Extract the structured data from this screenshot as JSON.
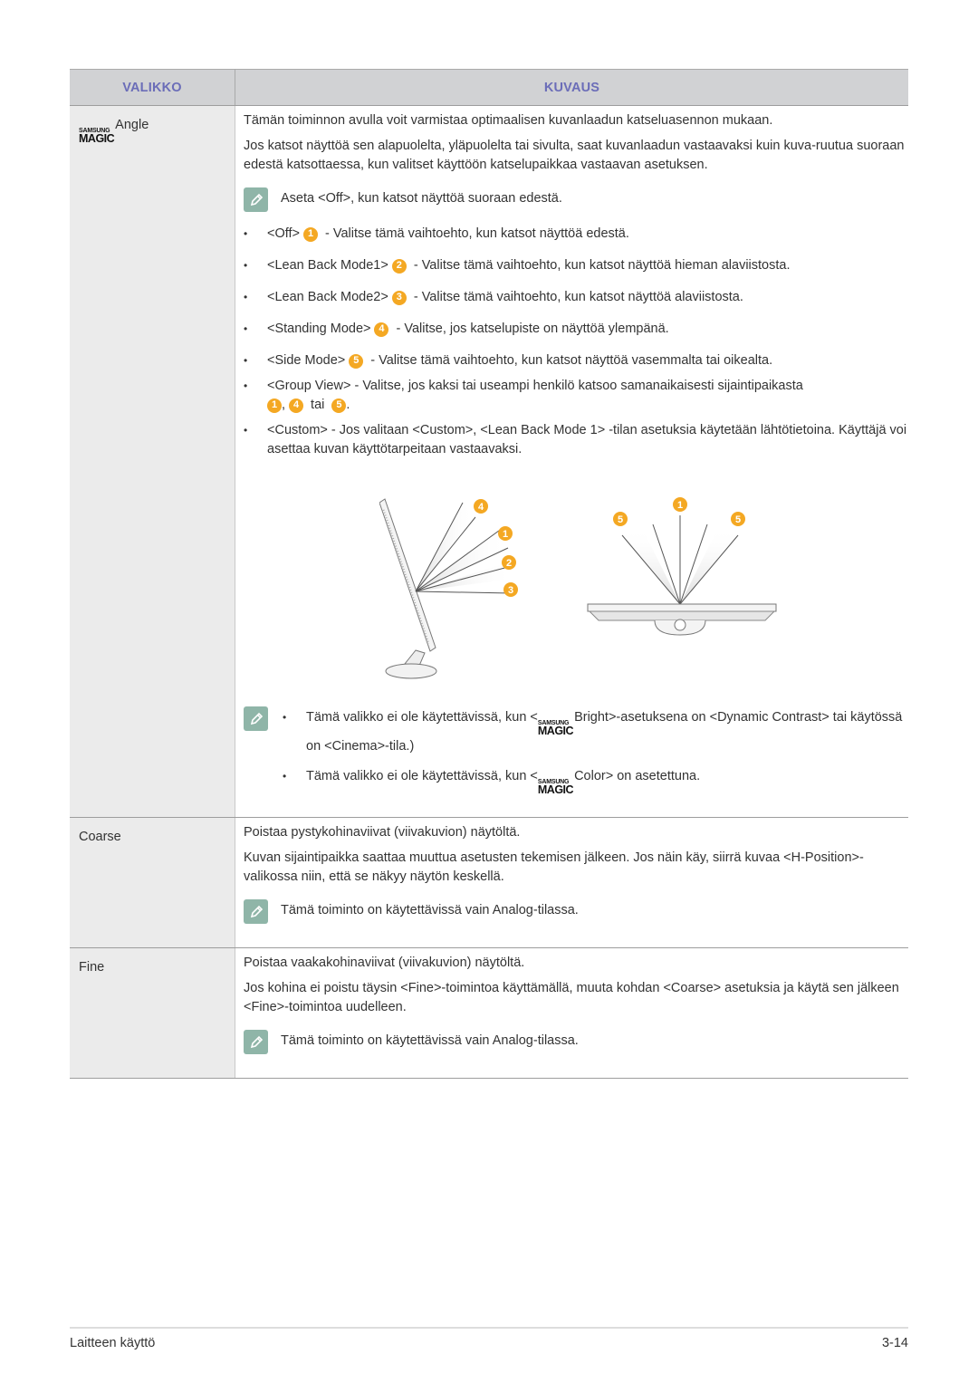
{
  "header": {
    "col_menu": "VALIKKO",
    "col_desc": "KUVAUS"
  },
  "colors": {
    "header_text": "#6b6db8",
    "header_bg": "#d1d2d4",
    "menu_col_bg": "#ebebeb",
    "badge": "#f4a823",
    "note_icon": "#8fb5a8"
  },
  "rows": {
    "angle": {
      "menu_brand_top": "SAMSUNG",
      "menu_brand_bottom": "MAGIC",
      "menu_label": "Angle",
      "p1": "Tämän toiminnon avulla voit varmistaa optimaalisen kuvanlaadun katseluasennon mukaan.",
      "p2": "Jos katsot näyttöä sen alapuolelta, yläpuolelta tai sivulta, saat kuvanlaadun vastaavaksi kuin kuva-ruutua suoraan edestä katsottaessa, kun valitset käyttöön katselupaikkaa vastaavan asetuksen.",
      "note": "Aseta <Off>, kun katsot näyttöä suoraan edestä.",
      "options": [
        {
          "name": "<Off>",
          "badge": "1",
          "desc": " - Valitse tämä vaihtoehto, kun katsot näyttöä edestä."
        },
        {
          "name": "<Lean Back Mode1>",
          "badge": "2",
          "desc": " - Valitse tämä vaihtoehto, kun katsot näyttöä hieman alaviistosta."
        },
        {
          "name": "<Lean Back Mode2>",
          "badge": "3",
          "desc": " - Valitse tämä vaihtoehto, kun katsot näyttöä alaviistosta."
        },
        {
          "name": "<Standing Mode>",
          "badge": "4",
          "desc": " - Valitse, jos katselupiste on näyttöä ylempänä."
        },
        {
          "name": "<Side Mode>",
          "badge": "5",
          "desc": " - Valitse tämä vaihtoehto, kun katsot näyttöä vasemmalta tai oikealta."
        }
      ],
      "group_view": {
        "text": "<Group View> - Valitse, jos kaksi tai useampi henkilö katsoo samanaikaisesti sijaintipaikasta",
        "badge_a": "1",
        "sep1": ",",
        "badge_b": "4",
        "sep2": " tai ",
        "badge_c": "5",
        "end": "."
      },
      "custom": "<Custom> - Jos valitaan <Custom>, <Lean Back Mode 1> -tilan asetuksia käytetään lähtötietoina. Käyttäjä voi asettaa kuvan käyttötarpeitaan vastaavaksi.",
      "figure": {
        "side_badges": [
          "4",
          "1",
          "2",
          "3"
        ],
        "top_badges": [
          "5",
          "1",
          "5"
        ]
      },
      "restrictions": {
        "r1_pre": "Tämä valikko ei ole käytettävissä, kun <",
        "r1_feature": "Bright",
        "r1_post": ">-asetuksena on <Dynamic Contrast> tai käytössä on <Cinema>-tila.)",
        "r2_pre": "Tämä valikko ei ole käytettävissä, kun <",
        "r2_feature": "Color",
        "r2_post": "> on asetettuna."
      }
    },
    "coarse": {
      "menu_label": "Coarse",
      "p1": "Poistaa pystykohinaviivat (viivakuvion) näytöltä.",
      "p2": "Kuvan sijaintipaikka saattaa muuttua asetusten tekemisen jälkeen. Jos näin käy, siirrä kuvaa <H-Position>-valikossa niin, että se näkyy näytön keskellä.",
      "note": "Tämä toiminto on käytettävissä vain Analog-tilassa."
    },
    "fine": {
      "menu_label": "Fine",
      "p1": "Poistaa vaakakohinaviivat (viivakuvion) näytöltä.",
      "p2": "Jos kohina ei poistu täysin <Fine>-toimintoa käyttämällä, muuta kohdan <Coarse> asetuksia ja käytä sen jälkeen <Fine>-toimintoa uudelleen.",
      "note": "Tämä toiminto on käytettävissä vain Analog-tilassa."
    }
  },
  "footer": {
    "section": "Laitteen käyttö",
    "page": "3-14"
  }
}
